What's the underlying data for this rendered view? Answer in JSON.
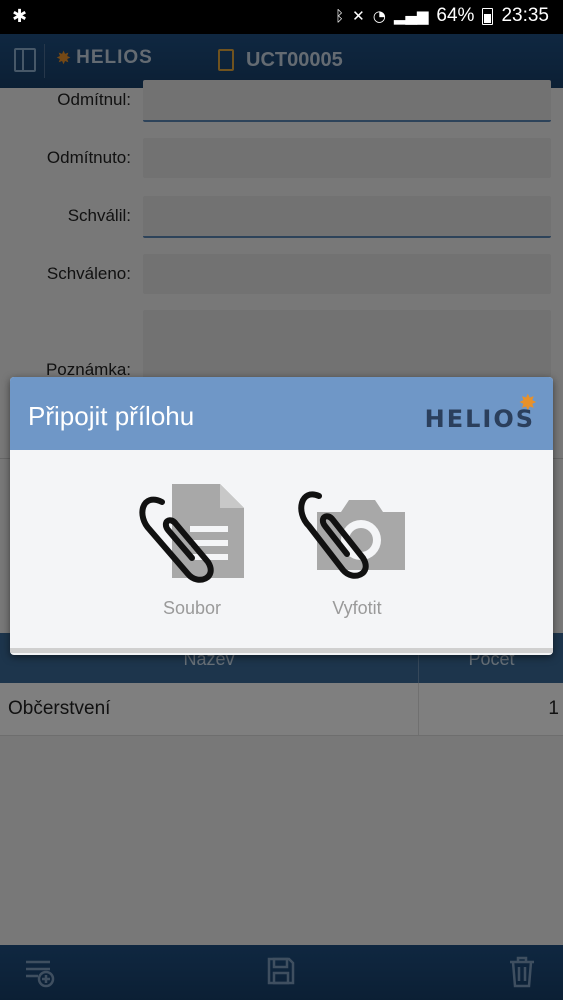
{
  "status_bar": {
    "battery": "64%",
    "time": "23:35"
  },
  "app_bar": {
    "logo_text": "HELIOS",
    "document_id": "UCT00005"
  },
  "form": {
    "fields": [
      {
        "label": "Odmítnul:",
        "value": ""
      },
      {
        "label": "Odmítnuto:",
        "value": ""
      },
      {
        "label": "Schválil:",
        "value": ""
      },
      {
        "label": "Schváleno:",
        "value": ""
      },
      {
        "label": "Poznámka:",
        "value": ""
      }
    ]
  },
  "list": {
    "columns": [
      "Název",
      "Počet"
    ],
    "rows": [
      {
        "name": "Občerstvení",
        "count": "1"
      }
    ]
  },
  "dialog": {
    "title": "Připojit přílohu",
    "logo_text": "HELIOS",
    "options": [
      {
        "label": "Soubor",
        "icon": "attach-file-icon"
      },
      {
        "label": "Vyfotit",
        "icon": "attach-camera-icon"
      }
    ]
  },
  "bottom_bar": {
    "icons": [
      "add-item-icon",
      "save-icon",
      "delete-icon"
    ]
  },
  "colors": {
    "app_bar": "#1f4f82",
    "dialog_header": "#6f97c7",
    "accent_orange": "#e8912a"
  }
}
